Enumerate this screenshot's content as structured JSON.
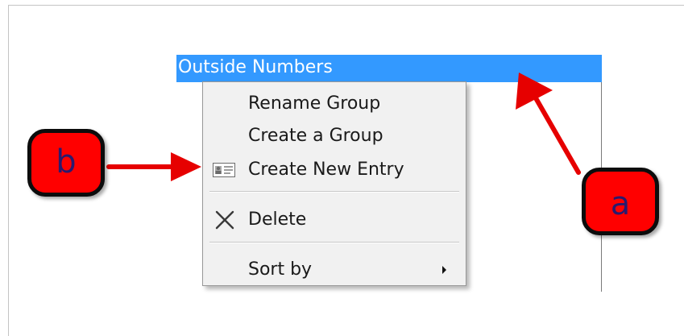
{
  "list": {
    "selected_group": "Outside Numbers"
  },
  "context_menu": {
    "items": [
      {
        "label": "Rename Group"
      },
      {
        "label": "Create a Group"
      },
      {
        "label": "Create New Entry",
        "icon": "contact-card-icon"
      },
      {
        "label": "Delete",
        "icon": "delete-x-icon"
      },
      {
        "label": "Sort by",
        "submenu": true
      }
    ]
  },
  "annotations": {
    "callout_a": "a",
    "callout_b": "b"
  },
  "colors": {
    "selection": "#3399ff",
    "callout_fill": "#ff0000",
    "arrow": "#e60000"
  }
}
